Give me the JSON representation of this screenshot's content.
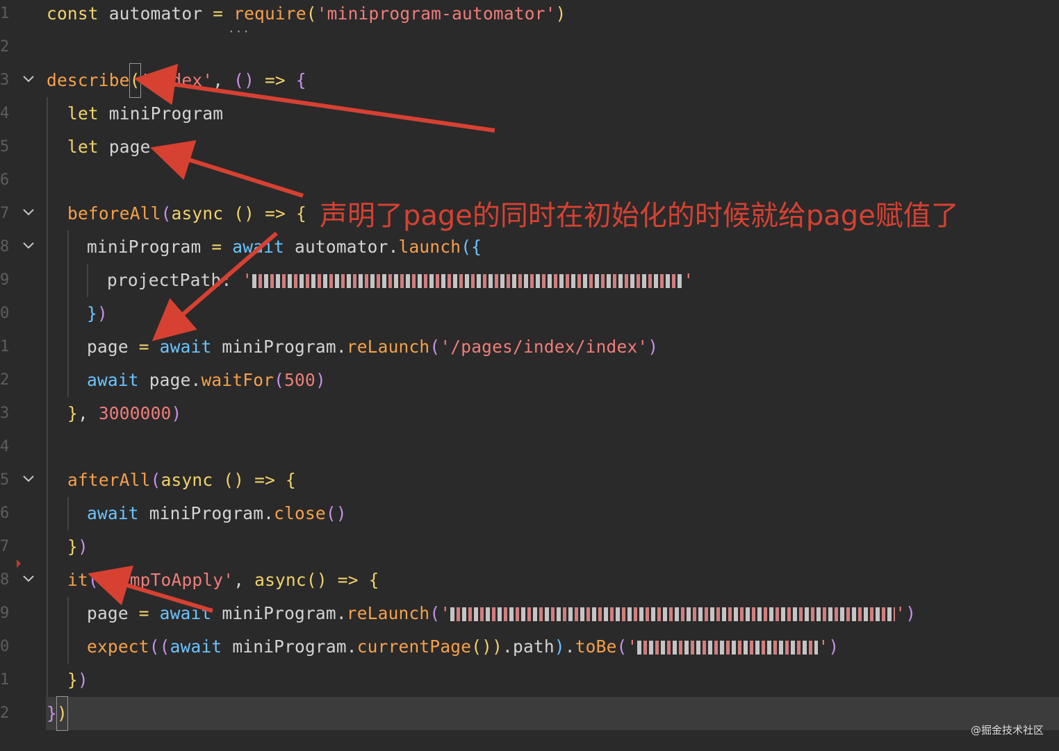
{
  "lines": [
    {
      "n": "1"
    },
    {
      "n": "2"
    },
    {
      "n": "3"
    },
    {
      "n": "4"
    },
    {
      "n": "5"
    },
    {
      "n": "6"
    },
    {
      "n": "7"
    },
    {
      "n": "8"
    },
    {
      "n": "9"
    },
    {
      "n": "0"
    },
    {
      "n": "1"
    },
    {
      "n": "2"
    },
    {
      "n": "3"
    },
    {
      "n": "4"
    },
    {
      "n": "5"
    },
    {
      "n": "6"
    },
    {
      "n": "7"
    },
    {
      "n": "8"
    },
    {
      "n": "9"
    },
    {
      "n": "0"
    },
    {
      "n": "1"
    },
    {
      "n": "2"
    }
  ],
  "code": {
    "l1": {
      "kw": "const",
      "ident": " automator ",
      "op": "=",
      "fn": " require",
      "open": "(",
      "str": "'miniprogram-automator'",
      "close": ")"
    },
    "l3": {
      "fn": "describe",
      "open": "(",
      "str": "'index'",
      "comma": ", ",
      "params": "()",
      "arrow": " => ",
      "brace": "{"
    },
    "l4": {
      "kw": "let",
      "ident": " miniProgram"
    },
    "l5": {
      "kw": "let",
      "ident": " page"
    },
    "l7": {
      "fn": "beforeAll",
      "open": "(",
      "kw": "async",
      "params": " ()",
      "arrow": " => ",
      "brace": "{"
    },
    "l8": {
      "ident": "miniProgram ",
      "op": "=",
      "aw": " await",
      "ident2": " automator",
      "dot": ".",
      "fn": "launch",
      "open": "(",
      "brace": "{"
    },
    "l9": {
      "ident": "projectPath",
      "colon": ": ",
      "str_open": "'",
      "str_close": "'"
    },
    "l10": {
      "brace": "}",
      "close": ")"
    },
    "l11": {
      "ident": "page ",
      "op": "=",
      "aw": " await",
      "ident2": " miniProgram",
      "dot": ".",
      "fn": "reLaunch",
      "open": "(",
      "str": "'/pages/index/index'",
      "close": ")"
    },
    "l12": {
      "aw": "await",
      "ident": " page",
      "dot": ".",
      "fn": "waitFor",
      "open": "(",
      "num": "500",
      "close": ")"
    },
    "l13": {
      "brace": "}",
      "comma": ", ",
      "num": "3000000",
      "close": ")"
    },
    "l15": {
      "fn": "afterAll",
      "open": "(",
      "kw": "async",
      "params": " ()",
      "arrow": " => ",
      "brace": "{"
    },
    "l16": {
      "aw": "await",
      "ident": " miniProgram",
      "dot": ".",
      "fn": "close",
      "params": "()"
    },
    "l17": {
      "brace": "}",
      "close": ")"
    },
    "l18": {
      "fn": "it",
      "open": "(",
      "str": "'jumpToApply'",
      "comma": ", ",
      "kw": "async",
      "params": "()",
      "arrow": " => ",
      "brace": "{"
    },
    "l19": {
      "ident": "page ",
      "op": "=",
      "aw": " await",
      "ident2": " miniProgram",
      "dot": ".",
      "fn": "reLaunch",
      "open": "(",
      "str_open": "'",
      "str_close": "'",
      "close": ")"
    },
    "l20": {
      "fn": "expect",
      "open": "((",
      "aw": "await",
      "ident": " miniProgram",
      "dot": ".",
      "fn2": "currentPage",
      "params": "())",
      "dot2": ".",
      "ident2": "path",
      "close1": ")",
      "dot3": ".",
      "fn3": "toBe",
      "open2": "(",
      "str_open": "'",
      "str_close": "'",
      "close": ")"
    },
    "l21": {
      "brace": "}",
      "close": ")"
    },
    "l22": {
      "brace": "}",
      "close": ")"
    }
  },
  "annotation": {
    "text": "声明了page的同时在初始化的时候就给page赋值了",
    "color": "#d64132"
  },
  "watermark": "@掘金技术社区"
}
